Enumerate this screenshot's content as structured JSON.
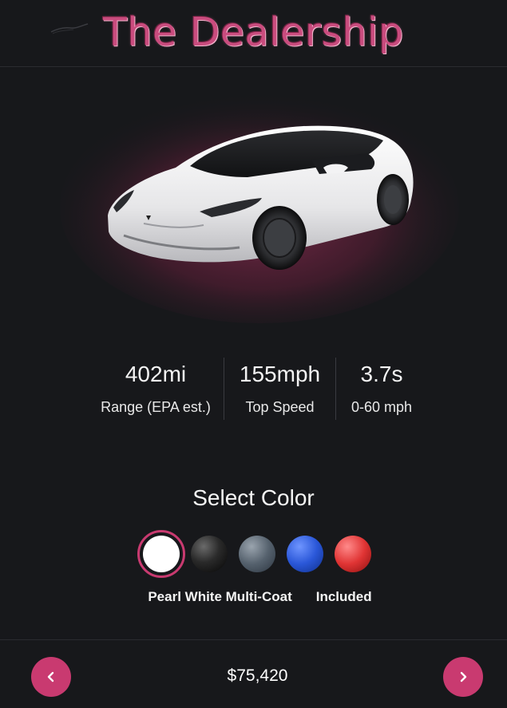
{
  "header": {
    "title": "The Dealership"
  },
  "car": {
    "image_icon": "car-image",
    "glow_color": "#c93a70"
  },
  "specs": [
    {
      "value": "402mi",
      "label": "Range (EPA est.)"
    },
    {
      "value": "155mph",
      "label": "Top Speed"
    },
    {
      "value": "3.7s",
      "label": "0-60 mph"
    }
  ],
  "colors": {
    "title": "Select Color",
    "options": [
      {
        "color": "#ffffff",
        "selected": true
      },
      {
        "color": "#1f1f1f",
        "selected": false
      },
      {
        "color": "#4d5966",
        "selected": false
      },
      {
        "color": "#2a57d8",
        "selected": false
      },
      {
        "color": "#d83232",
        "selected": false
      }
    ],
    "selected_name": "Pearl White Multi-Coat",
    "selected_price": "Included"
  },
  "footer": {
    "price": "$75,420",
    "prev_icon": "chevron-left-icon",
    "next_icon": "chevron-right-icon"
  },
  "theme": {
    "accent": "#c93a70",
    "background": "#17181b"
  }
}
